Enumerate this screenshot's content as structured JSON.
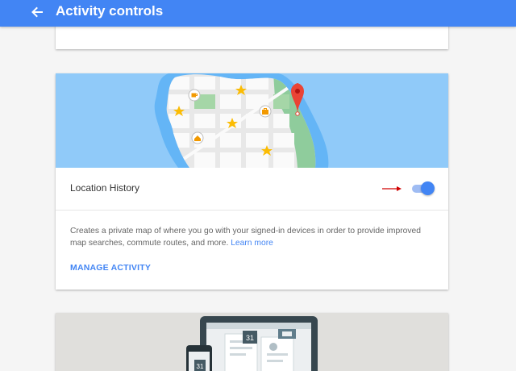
{
  "appbar": {
    "title": "Activity controls",
    "back_icon": "arrow-back-icon",
    "color": "#4285f4"
  },
  "location_history": {
    "label": "Location History",
    "enabled": true,
    "description": "Creates a private map of where you go with your signed-in devices in order to provide improved map searches, commute routes, and more.",
    "learn_more": "Learn more",
    "manage_label": "MANAGE ACTIVITY"
  },
  "illustration": {
    "map_icons": [
      "coffee-icon",
      "briefcase-icon",
      "home-icon",
      "star-icon",
      "map-pin-icon"
    ],
    "calendar_day": "31"
  },
  "colors": {
    "accent": "#4285f4",
    "pin": "#ea4335",
    "star": "#fbbc04",
    "arrow": "#d00000"
  }
}
